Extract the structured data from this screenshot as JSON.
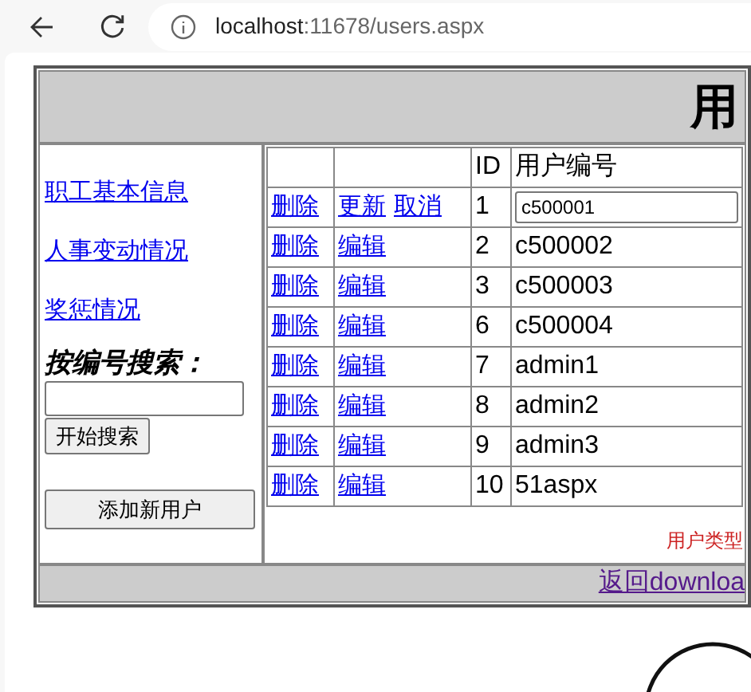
{
  "browser": {
    "url_host": "localhost",
    "url_path": ":11678/users.aspx"
  },
  "title": "用",
  "sidebar": {
    "links": [
      "职工基本信息",
      "人事变动情况",
      "奖惩情况"
    ],
    "search_label": "按编号搜索：",
    "search_button": "开始搜索",
    "add_button": "添加新用户"
  },
  "table": {
    "columns": [
      "",
      "",
      "ID",
      "用户编号"
    ],
    "rows": [
      {
        "delete": "删除",
        "actions": [
          "更新",
          "取消"
        ],
        "id": "1",
        "user_no": "c500001",
        "editing": true
      },
      {
        "delete": "删除",
        "actions": [
          "编辑"
        ],
        "id": "2",
        "user_no": "c500002",
        "editing": false
      },
      {
        "delete": "删除",
        "actions": [
          "编辑"
        ],
        "id": "3",
        "user_no": "c500003",
        "editing": false
      },
      {
        "delete": "删除",
        "actions": [
          "编辑"
        ],
        "id": "6",
        "user_no": "c500004",
        "editing": false
      },
      {
        "delete": "删除",
        "actions": [
          "编辑"
        ],
        "id": "7",
        "user_no": "admin1",
        "editing": false
      },
      {
        "delete": "删除",
        "actions": [
          "编辑"
        ],
        "id": "8",
        "user_no": "admin2",
        "editing": false
      },
      {
        "delete": "删除",
        "actions": [
          "编辑"
        ],
        "id": "9",
        "user_no": "admin3",
        "editing": false
      },
      {
        "delete": "删除",
        "actions": [
          "编辑"
        ],
        "id": "10",
        "user_no": "51aspx",
        "editing": false
      }
    ]
  },
  "user_type_label": "用户类型",
  "footer_link": "返回downloa"
}
